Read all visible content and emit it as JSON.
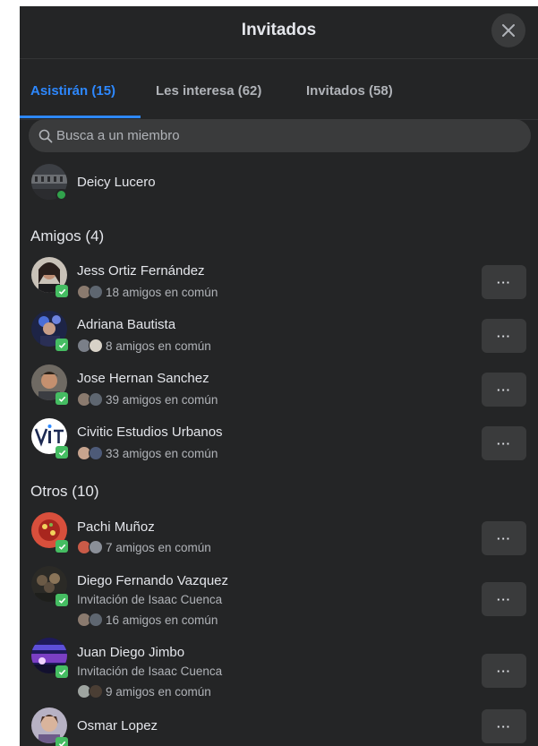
{
  "header": {
    "title": "Invitados"
  },
  "tabs": [
    {
      "label": "Asistirán (15)",
      "active": true
    },
    {
      "label": "Les interesa (62)",
      "active": false
    },
    {
      "label": "Invitados (58)",
      "active": false
    }
  ],
  "search": {
    "placeholder": "Busca a un miembro"
  },
  "host": {
    "name": "Deicy Lucero"
  },
  "sections": {
    "friends_title": "Amigos (4)",
    "others_title": "Otros (10)"
  },
  "friends": [
    {
      "name": "Jess Ortiz Fernández",
      "mutual": "18 amigos en común"
    },
    {
      "name": "Adriana Bautista",
      "mutual": "8 amigos en común"
    },
    {
      "name": "Jose Hernan Sanchez",
      "mutual": "39 amigos en común"
    },
    {
      "name": "Civitic Estudios Urbanos",
      "mutual": "33 amigos en común"
    }
  ],
  "others": [
    {
      "name": "Pachi Muñoz",
      "invite": "",
      "mutual": "7 amigos en común"
    },
    {
      "name": "Diego Fernando Vazquez",
      "invite": "Invitación de Isaac Cuenca",
      "mutual": "16 amigos en común"
    },
    {
      "name": "Juan Diego Jimbo",
      "invite": "Invitación de Isaac Cuenca",
      "mutual": "9 amigos en común"
    },
    {
      "name": "Osmar Lopez",
      "invite": "",
      "mutual": ""
    }
  ],
  "more_label": "···",
  "colors": {
    "accent": "#2d88ff",
    "badge": "#45bd62",
    "panel": "#242526"
  }
}
